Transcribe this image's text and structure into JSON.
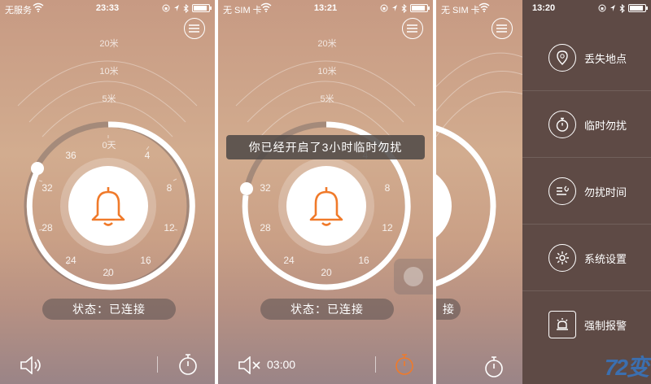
{
  "screens": [
    {
      "status": {
        "carrier": "无服务",
        "time": "23:33"
      },
      "distances": [
        "20米",
        "10米",
        "5米",
        "0天"
      ],
      "ticks": [
        "36",
        "4",
        "8",
        "12",
        "16",
        "20",
        "24",
        "28",
        "32"
      ],
      "state_text": "状态：已连接",
      "icons": {
        "sound": "speaker-icon",
        "timer": "stopwatch-icon"
      }
    },
    {
      "status": {
        "carrier": "无 SIM 卡",
        "time": "13:21"
      },
      "distances": [
        "20米",
        "10米",
        "5米"
      ],
      "ticks": [
        "4",
        "8",
        "12",
        "16",
        "20",
        "24",
        "28",
        "32"
      ],
      "toast": "你已经开启了3小时临时勿扰",
      "state_text": "状态：已连接",
      "timer_text": "03:00",
      "accent": "#f07a2a"
    },
    {
      "status": {
        "carrier": "无 SIM 卡",
        "time": "13:20"
      },
      "state_text": "接",
      "menu": [
        {
          "label": "丢失地点",
          "icon": "location-pin-icon"
        },
        {
          "label": "临时勿扰",
          "icon": "stopwatch-icon"
        },
        {
          "label": "勿扰时间",
          "icon": "list-moon-icon"
        },
        {
          "label": "系统设置",
          "icon": "gear-icon"
        },
        {
          "label": "强制报警",
          "icon": "alarm-light-icon"
        }
      ]
    }
  ],
  "watermark": {
    "a": "72",
    "b": "变"
  }
}
